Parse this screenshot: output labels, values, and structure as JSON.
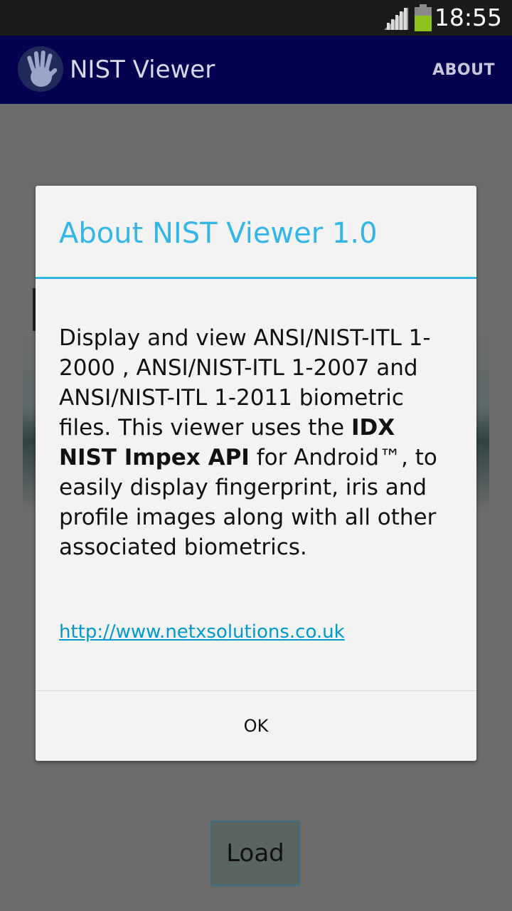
{
  "status_bar": {
    "time": "18:55"
  },
  "action_bar": {
    "title": "NIST Viewer",
    "about_label": "ABOUT"
  },
  "main": {
    "load_label": "Load"
  },
  "dialog": {
    "title": "About NIST Viewer 1.0",
    "body_part1": "Display and view ANSI/NIST-ITL 1-2000 , ANSI/NIST-ITL 1-2007 and ANSI/NIST-ITL 1-2011 biometric files. This viewer uses the ",
    "body_bold": "IDX NIST Impex API",
    "body_part2": " for Android™, to easily display fingerprint, iris and profile images along with all other associated biometrics.",
    "link": "http://www.netxsolutions.co.uk",
    "ok_label": "OK"
  },
  "colors": {
    "accent": "#33b5e5",
    "action_bar": "#03034f",
    "link": "#0099cc",
    "battery": "#8ec21f"
  }
}
